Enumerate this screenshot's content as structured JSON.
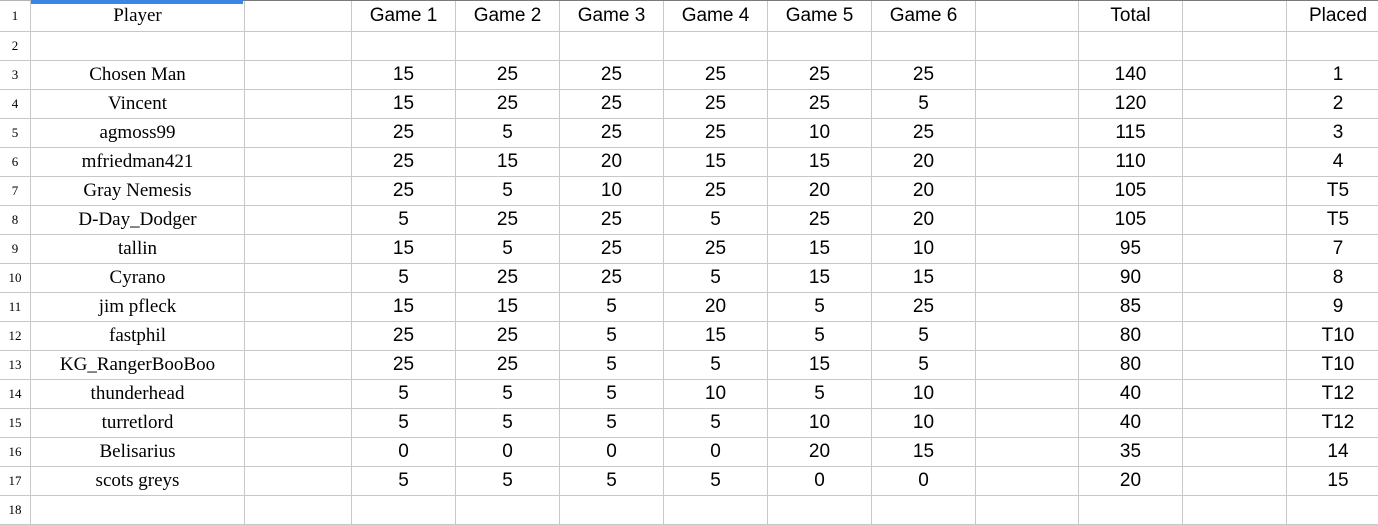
{
  "app": {
    "type": "spreadsheet",
    "selection_accent_color": "#3b86e0",
    "gutter_color": "#ececec",
    "gridline_color": "#c8c8c8"
  },
  "row_headers": [
    "1",
    "2",
    "3",
    "4",
    "5",
    "6",
    "7",
    "8",
    "9",
    "10",
    "11",
    "12",
    "13",
    "14",
    "15",
    "16",
    "17",
    "18"
  ],
  "columns": {
    "player": "Player",
    "games": [
      "Game 1",
      "Game 2",
      "Game 3",
      "Game 4",
      "Game 5",
      "Game 6"
    ],
    "total": "Total",
    "placed": "Placed"
  },
  "chart_data": {
    "type": "table",
    "title": "Player",
    "columns": [
      "Player",
      "Game 1",
      "Game 2",
      "Game 3",
      "Game 4",
      "Game 5",
      "Game 6",
      "Total",
      "Placed"
    ],
    "rows": [
      {
        "row": "3",
        "player": "Chosen Man",
        "games": [
          "15",
          "25",
          "25",
          "25",
          "25",
          "25"
        ],
        "total": "140",
        "placed": "1"
      },
      {
        "row": "4",
        "player": "Vincent",
        "games": [
          "15",
          "25",
          "25",
          "25",
          "25",
          "5"
        ],
        "total": "120",
        "placed": "2"
      },
      {
        "row": "5",
        "player": "agmoss99",
        "games": [
          "25",
          "5",
          "25",
          "25",
          "10",
          "25"
        ],
        "total": "115",
        "placed": "3"
      },
      {
        "row": "6",
        "player": "mfriedman421",
        "games": [
          "25",
          "15",
          "20",
          "15",
          "15",
          "20"
        ],
        "total": "110",
        "placed": "4"
      },
      {
        "row": "7",
        "player": "Gray Nemesis",
        "games": [
          "25",
          "5",
          "10",
          "25",
          "20",
          "20"
        ],
        "total": "105",
        "placed": "T5"
      },
      {
        "row": "8",
        "player": "D-Day_Dodger",
        "games": [
          "5",
          "25",
          "25",
          "5",
          "25",
          "20"
        ],
        "total": "105",
        "placed": "T5"
      },
      {
        "row": "9",
        "player": "tallin",
        "games": [
          "15",
          "5",
          "25",
          "25",
          "15",
          "10"
        ],
        "total": "95",
        "placed": "7"
      },
      {
        "row": "10",
        "player": "Cyrano",
        "games": [
          "5",
          "25",
          "25",
          "5",
          "15",
          "15"
        ],
        "total": "90",
        "placed": "8"
      },
      {
        "row": "11",
        "player": "jim pfleck",
        "games": [
          "15",
          "15",
          "5",
          "20",
          "5",
          "25"
        ],
        "total": "85",
        "placed": "9"
      },
      {
        "row": "12",
        "player": "fastphil",
        "games": [
          "25",
          "25",
          "5",
          "15",
          "5",
          "5"
        ],
        "total": "80",
        "placed": "T10"
      },
      {
        "row": "13",
        "player": "KG_RangerBooBoo",
        "games": [
          "25",
          "25",
          "5",
          "5",
          "15",
          "5"
        ],
        "total": "80",
        "placed": "T10"
      },
      {
        "row": "14",
        "player": "thunderhead",
        "games": [
          "5",
          "5",
          "5",
          "10",
          "5",
          "10"
        ],
        "total": "40",
        "placed": "T12"
      },
      {
        "row": "15",
        "player": "turretlord",
        "games": [
          "5",
          "5",
          "5",
          "5",
          "10",
          "10"
        ],
        "total": "40",
        "placed": "T12"
      },
      {
        "row": "16",
        "player": "Belisarius",
        "games": [
          "0",
          "0",
          "0",
          "0",
          "20",
          "15"
        ],
        "total": "35",
        "placed": "14"
      },
      {
        "row": "17",
        "player": "scots greys",
        "games": [
          "5",
          "5",
          "5",
          "5",
          "0",
          "0"
        ],
        "total": "20",
        "placed": "15"
      }
    ]
  }
}
